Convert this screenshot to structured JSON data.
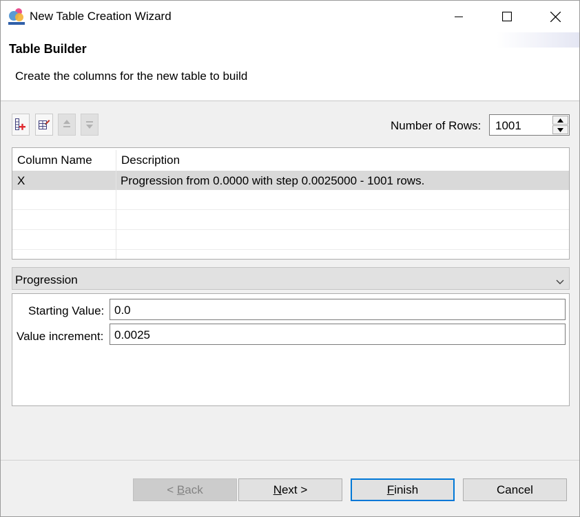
{
  "window": {
    "title": "New Table Creation Wizard",
    "controls": [
      "minimize",
      "maximize",
      "close"
    ]
  },
  "header": {
    "title": "Table Builder",
    "subtitle": "Create the columns for the new table to build"
  },
  "toolbar": {
    "buttons": [
      {
        "icon": "add-column-icon",
        "enabled": true
      },
      {
        "icon": "edit-column-icon",
        "enabled": true
      },
      {
        "icon": "move-up-icon",
        "enabled": false
      },
      {
        "icon": "move-down-icon",
        "enabled": false
      }
    ],
    "rows_label": "Number of Rows:",
    "rows_value": "1001"
  },
  "table": {
    "columns": [
      "Column Name",
      "Description"
    ],
    "rows": [
      {
        "name": "X",
        "description": "Progression from 0.0000 with step 0.0025000 - 1001 rows.",
        "selected": true
      }
    ]
  },
  "generator": {
    "selected": "Progression",
    "fields": [
      {
        "label": "Starting Value:",
        "value": "0.0"
      },
      {
        "label": "Value increment:",
        "value": "0.0025"
      }
    ]
  },
  "buttons": {
    "back_prefix": "< ",
    "back_mnemonic": "B",
    "back_rest": "ack",
    "back_enabled": false,
    "next_mnemonic": "N",
    "next_rest": "ext >",
    "finish_mnemonic": "F",
    "finish_rest": "inish",
    "cancel": "Cancel"
  },
  "colors": {
    "accent": "#0078d7",
    "selection": "#d9d9d9",
    "add_icon_plus": "#e0282d"
  }
}
